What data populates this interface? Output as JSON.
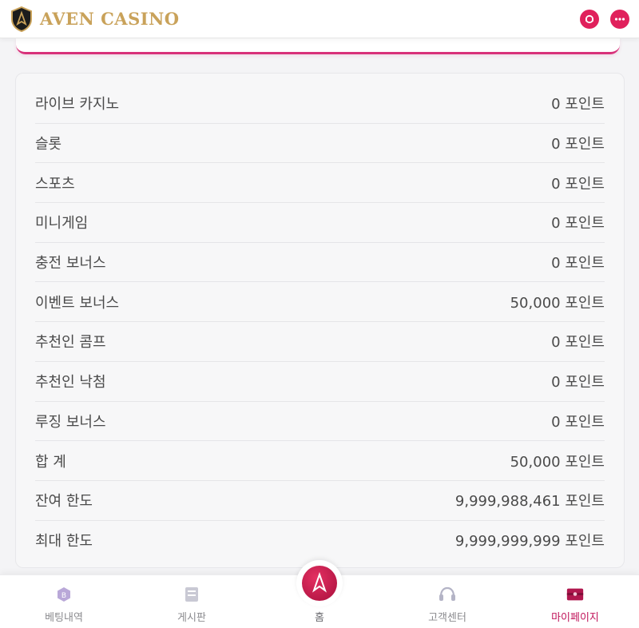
{
  "header": {
    "brand": "AVEN CASINO",
    "logo_icon": "aven-shield-logo-icon",
    "actions": [
      "support-icon",
      "more-icon"
    ]
  },
  "summary": {
    "rows": [
      {
        "label": "라이브 카지노",
        "value": "0 포인트"
      },
      {
        "label": "슬롯",
        "value": "0 포인트"
      },
      {
        "label": "스포츠",
        "value": "0 포인트"
      },
      {
        "label": "미니게임",
        "value": "0 포인트"
      },
      {
        "label": "충전 보너스",
        "value": "0 포인트"
      },
      {
        "label": "이벤트 보너스",
        "value": "50,000 포인트"
      },
      {
        "label": "추천인 콤프",
        "value": "0 포인트"
      },
      {
        "label": "추천인 낙첨",
        "value": "0 포인트"
      },
      {
        "label": "루징 보너스",
        "value": "0 포인트"
      },
      {
        "label": "합 계",
        "value": "50,000 포인트"
      },
      {
        "label": "잔여 한도",
        "value": "9,999,988,461 포인트"
      },
      {
        "label": "최대 한도",
        "value": "9,999,999,999 포인트"
      }
    ]
  },
  "bottom_nav": {
    "items": [
      {
        "label": "베팅내역",
        "icon": "betting-history-icon",
        "active": false
      },
      {
        "label": "게시판",
        "icon": "board-icon",
        "active": false
      },
      {
        "label": "홈",
        "icon": "home-logo-icon",
        "active": false
      },
      {
        "label": "고객센터",
        "icon": "headset-icon",
        "active": false
      },
      {
        "label": "마이페이지",
        "icon": "mypage-icon",
        "active": true
      }
    ]
  },
  "colors": {
    "brand_gold": "#c9a25a",
    "accent_pink": "#e0215c",
    "active_nav": "#c0145a"
  }
}
